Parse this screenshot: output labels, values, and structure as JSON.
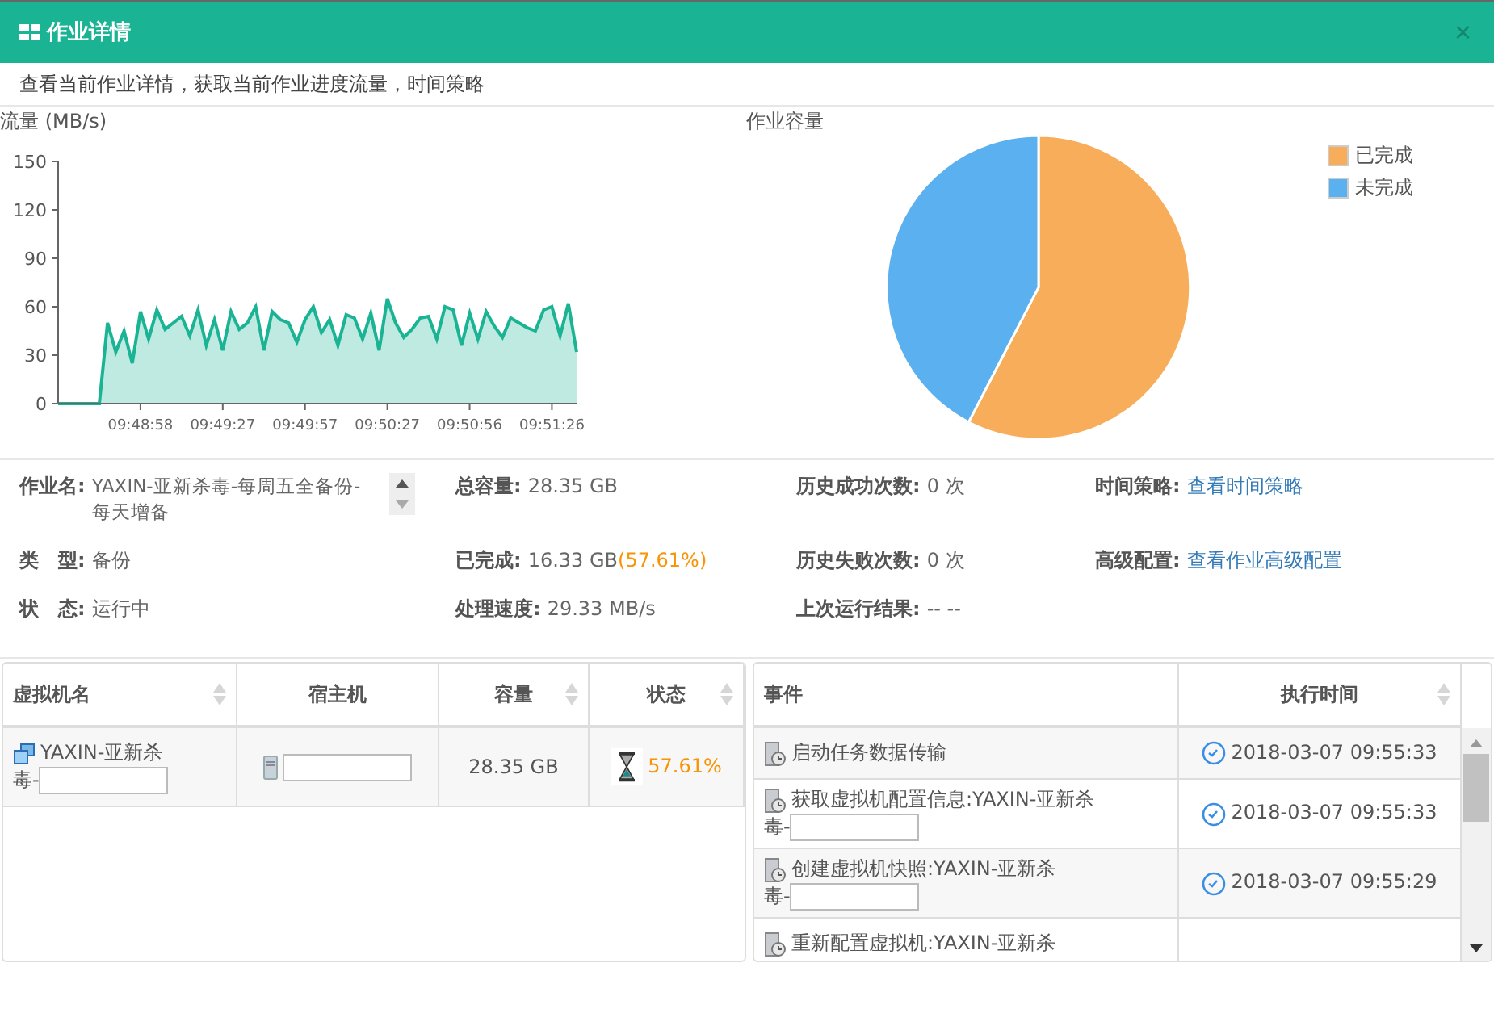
{
  "window": {
    "title": "作业详情",
    "close": "×"
  },
  "subtitle": "查看当前作业详情，获取当前作业进度流量，时间策略",
  "flow_chart": {
    "title": "流量 (MB/s)",
    "chart_data": {
      "type": "area",
      "categories": [
        null,
        null,
        null,
        null,
        null,
        null,
        null,
        null,
        null,
        null,
        "09:48:58",
        null,
        null,
        null,
        null,
        null,
        null,
        null,
        null,
        null,
        "09:49:27",
        null,
        null,
        null,
        null,
        null,
        null,
        null,
        null,
        null,
        "09:49:57",
        null,
        null,
        null,
        null,
        null,
        null,
        null,
        null,
        null,
        "09:50:27",
        null,
        null,
        null,
        null,
        null,
        null,
        null,
        null,
        null,
        "09:50:56",
        null,
        null,
        null,
        null,
        null,
        null,
        null,
        null,
        null,
        "09:51:26",
        null,
        null,
        null
      ],
      "series": [
        {
          "color": "#1ab394",
          "values": [
            0,
            0,
            0,
            0,
            0,
            0,
            50,
            32,
            45,
            25,
            57,
            40,
            58,
            46,
            50,
            54,
            42,
            58,
            36,
            52,
            33,
            57,
            46,
            50,
            60,
            33,
            57,
            52,
            50,
            38,
            52,
            60,
            44,
            52,
            36,
            55,
            53,
            40,
            56,
            33,
            65,
            50,
            41,
            46,
            53,
            54,
            40,
            60,
            58,
            36,
            56,
            40,
            57,
            48,
            41,
            53,
            50,
            47,
            45,
            58,
            60,
            42,
            62,
            32
          ]
        }
      ],
      "ylim": [
        0,
        150
      ],
      "yticks": [
        0,
        30,
        60,
        90,
        120,
        150
      ]
    }
  },
  "capacity_chart": {
    "title": "作业容量",
    "chart_data": {
      "type": "pie",
      "categories": [
        "已完成",
        "未完成"
      ],
      "series": [
        {
          "values": [
            57.61,
            42.39
          ]
        }
      ],
      "colors": [
        "#f8ad5a",
        "#5bb1ef"
      ]
    }
  },
  "info_rows": [
    [
      {
        "label": "作业名:",
        "value": "YAXIN-亚新杀毒-每周五全备份-每天增备",
        "kind": "scroll"
      },
      {
        "label": "总容量:",
        "value": "28.35 GB",
        "kind": "text"
      },
      {
        "label": "历史成功次数:",
        "value": "0 次",
        "kind": "text"
      },
      {
        "label": "时间策略:",
        "value": "查看时间策略",
        "kind": "link"
      }
    ],
    [
      {
        "label": "类　型:",
        "value": "备份",
        "kind": "text"
      },
      {
        "label": "已完成:",
        "value": "16.33 GB",
        "highlight": "(57.61%)",
        "kind": "text"
      },
      {
        "label": "历史失败次数:",
        "value": "0 次",
        "kind": "text"
      },
      {
        "label": "高级配置:",
        "value": "查看作业高级配置",
        "kind": "link"
      }
    ],
    [
      {
        "label": "状　态:",
        "value": "运行中",
        "kind": "text"
      },
      {
        "label": "处理速度:",
        "value": "29.33 MB/s",
        "kind": "text"
      },
      {
        "label": "上次运行结果:",
        "value": "-- --",
        "kind": "text"
      }
    ]
  ],
  "vm_table": {
    "columns": [
      {
        "label": "虚拟机名",
        "sortable": true
      },
      {
        "label": "宿主机",
        "sortable": false
      },
      {
        "label": "容量",
        "sortable": true
      },
      {
        "label": "状态",
        "sortable": true
      }
    ],
    "rows": [
      {
        "name": "YAXIN-亚新杀",
        "name_suffix": "毒-",
        "capacity": "28.35 GB",
        "progress": "57.61%"
      }
    ]
  },
  "event_table": {
    "columns": [
      {
        "label": "事件",
        "sortable": false
      },
      {
        "label": "执行时间",
        "sortable": true
      }
    ],
    "rows": [
      {
        "event": "启动任务数据传输",
        "time": "2018-03-07 09:55:33"
      },
      {
        "event": "获取虚拟机配置信息:YAXIN-亚新杀",
        "event_suffix": "毒-",
        "time": "2018-03-07 09:55:33"
      },
      {
        "event": "创建虚拟机快照:YAXIN-亚新杀",
        "event_suffix": "毒-",
        "time": "2018-03-07 09:55:29"
      },
      {
        "event": "重新配置虚拟机:YAXIN-亚新杀"
      }
    ]
  }
}
